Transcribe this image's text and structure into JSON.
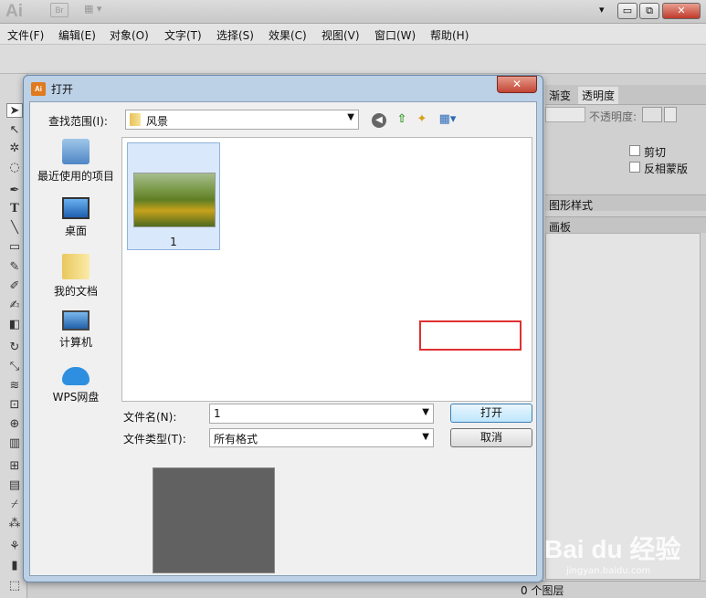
{
  "app": {
    "logo": "Ai",
    "bridge_label": "Br",
    "arrange_label": "▦ ▾",
    "dropdown_arrow": "▾"
  },
  "window_controls": {
    "minimize": "▭",
    "restore": "⧉",
    "close": "✕"
  },
  "menu": [
    "文件(F)",
    "编辑(E)",
    "对象(O)",
    "文字(T)",
    "选择(S)",
    "效果(C)",
    "视图(V)",
    "窗口(W)",
    "帮助(H)"
  ],
  "panels": {
    "tab_gradient": "渐变",
    "tab_transparency": "透明度",
    "opacity_label": "不透明度:",
    "clip_label": "剪切",
    "invert_mask_label": "反相蒙版",
    "graphic_styles_tab": "图形样式",
    "artboards_tab": "画板"
  },
  "status": {
    "layers": "0 个图层"
  },
  "dialog": {
    "title": "打开",
    "icon_label": "Ai",
    "close": "✕",
    "look_in_label": "查找范围(I):",
    "look_in_value": "风景",
    "places": [
      {
        "label": "最近使用的项目",
        "icon": "recent-items-icon"
      },
      {
        "label": "桌面",
        "icon": "desktop-icon"
      },
      {
        "label": "我的文档",
        "icon": "documents-folder-icon"
      },
      {
        "label": "计算机",
        "icon": "computer-icon"
      },
      {
        "label": "WPS网盘",
        "icon": "cloud-icon"
      }
    ],
    "files": [
      {
        "name": "1"
      }
    ],
    "file_name_label": "文件名(N):",
    "file_name_value": "1",
    "file_type_label": "文件类型(T):",
    "file_type_value": "所有格式",
    "open_button": "打开",
    "cancel_button": "取消"
  },
  "watermark": {
    "text": "Bai du 经验",
    "url": "jingyan.baidu.com"
  },
  "colors": {
    "dialog_frame": "#bcd0e6",
    "highlight": "#e03030",
    "open_button": "#bee6fd"
  }
}
